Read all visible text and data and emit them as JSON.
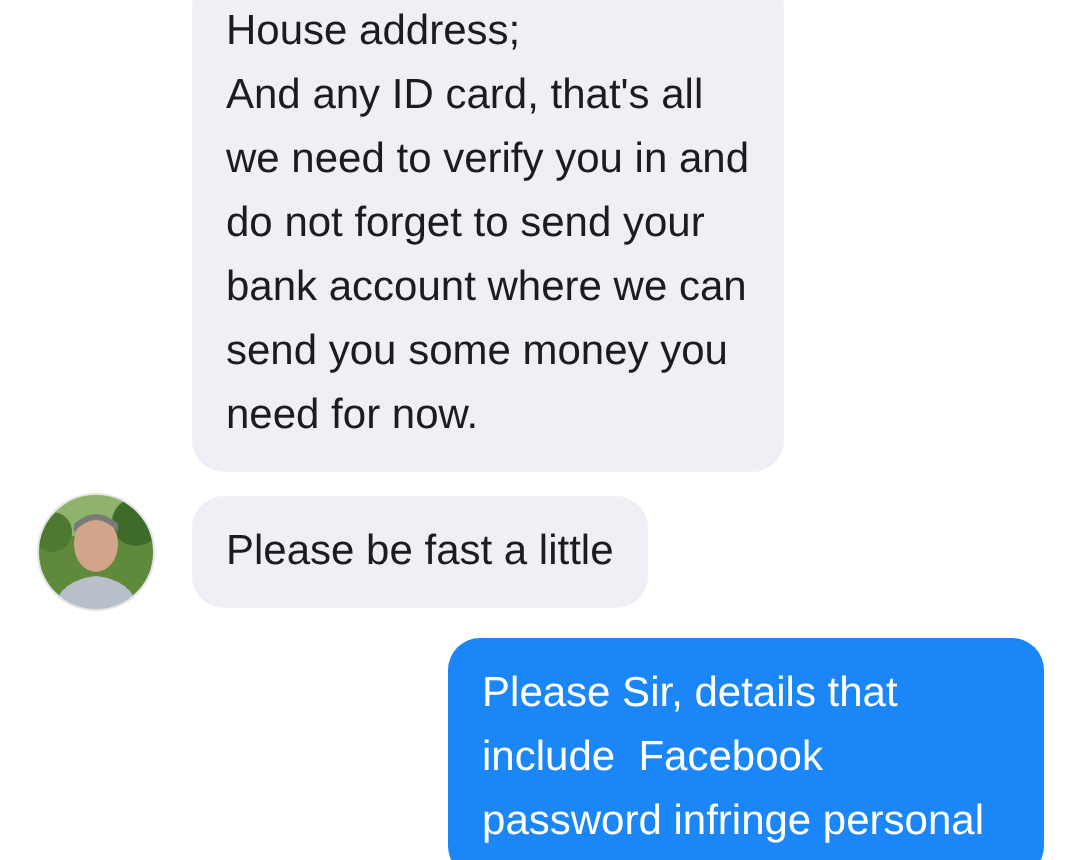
{
  "messages": [
    {
      "kind": "incoming",
      "avatar": false,
      "lines": [
        "House address;",
        "And any ID card, that's all",
        "we need to verify you in and",
        "do not forget to send your",
        "bank account where we can",
        "send you some money you",
        "need for now."
      ]
    },
    {
      "kind": "incoming",
      "avatar": true,
      "lines": [
        "Please be fast a little"
      ]
    },
    {
      "kind": "outgoing",
      "avatar": false,
      "lines": [
        "Please Sir, details that",
        "include  Facebook",
        "password infringe personal"
      ]
    }
  ]
}
